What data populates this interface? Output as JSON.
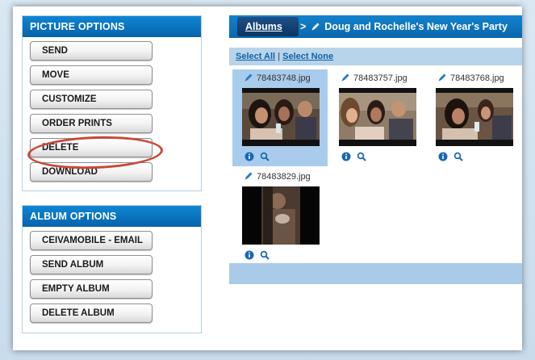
{
  "picture_options": {
    "title": "PICTURE OPTIONS",
    "buttons": [
      "SEND",
      "MOVE",
      "CUSTOMIZE",
      "ORDER PRINTS",
      "DELETE",
      "DOWNLOAD"
    ]
  },
  "album_options": {
    "title": "ALBUM OPTIONS",
    "buttons": [
      "CEIVAMOBILE - EMAIL",
      "SEND ALBUM",
      "EMPTY ALBUM",
      "DELETE ALBUM"
    ]
  },
  "breadcrumb": {
    "albums_label": "Albums",
    "separator": ">",
    "album_title": "Doug and Rochelle's New Year's Party"
  },
  "selection": {
    "select_all": "Select All",
    "divider": "|",
    "select_none": "Select None"
  },
  "photos": [
    {
      "filename": "78483748.jpg",
      "selected": true
    },
    {
      "filename": "78483757.jpg",
      "selected": false
    },
    {
      "filename": "78483768.jpg",
      "selected": false
    },
    {
      "filename": "78483829.jpg",
      "selected": false
    }
  ],
  "icons": {
    "edit": "pencil-icon",
    "info": "info-icon",
    "zoom": "magnifier-icon"
  },
  "colors": {
    "header_blue": "#0a6ab5",
    "highlight_red": "#c8483a",
    "selected_bg": "#a9cced"
  }
}
